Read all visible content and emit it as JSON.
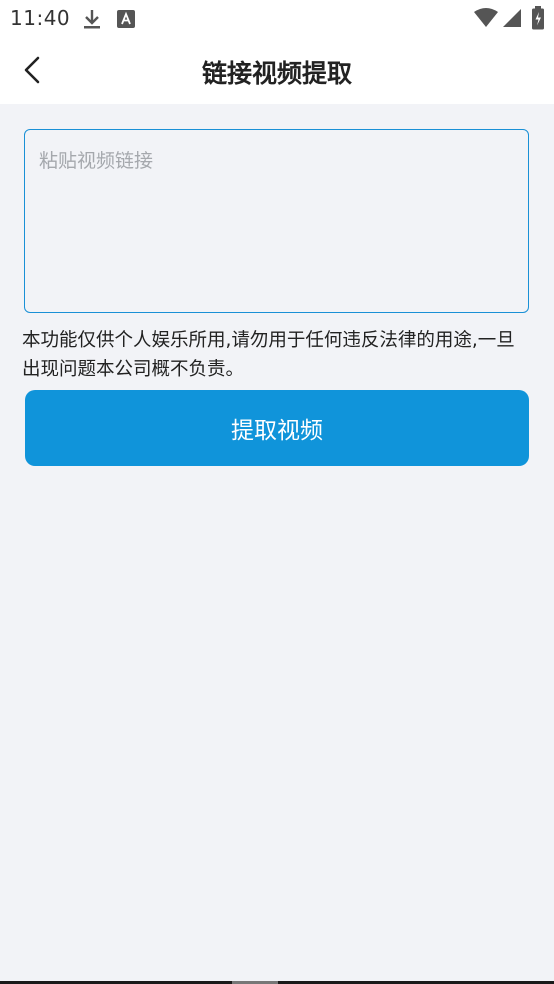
{
  "status_bar": {
    "time": "11:40",
    "icons": [
      "download-icon",
      "font-a-icon",
      "wifi-icon",
      "cell-signal-icon",
      "battery-icon"
    ]
  },
  "app_bar": {
    "title": "链接视频提取",
    "back_icon": "chevron-left-icon"
  },
  "form": {
    "link_placeholder": "粘贴视频链接",
    "link_value": "",
    "disclaimer": "本功能仅供个人娱乐所用,请勿用于任何违反法律的用途,一旦出现问题本公司概不负责。",
    "extract_label": "提取视频"
  },
  "colors": {
    "accent": "#1094da",
    "input_border": "#1a90d6",
    "background": "#f2f3f7",
    "placeholder": "#a5a8ad"
  }
}
